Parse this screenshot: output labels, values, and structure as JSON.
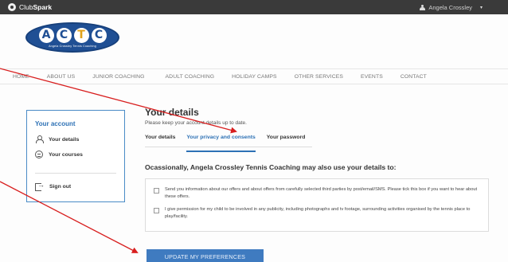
{
  "topbar": {
    "brand_prefix": "Club",
    "brand_suffix": "Spark",
    "user_name": "Angela Crossley",
    "chevron": "▾"
  },
  "logo": {
    "letters": [
      "A",
      "C",
      "T",
      "C"
    ],
    "subtitle": "Angela Crossley Tennis Coaching"
  },
  "nav": {
    "items": [
      "HOME",
      "ABOUT US",
      "JUNIOR COACHING",
      "ADULT COACHING",
      "HOLIDAY CAMPS",
      "OTHER SERVICES",
      "EVENTS",
      "CONTACT"
    ]
  },
  "sidebar": {
    "title": "Your account",
    "items": [
      {
        "label": "Your details",
        "icon": "person-icon"
      },
      {
        "label": "Your courses",
        "icon": "courses-icon"
      }
    ],
    "signout_label": "Sign out"
  },
  "main": {
    "title": "Your details",
    "subtitle": "Please keep your account details up to date.",
    "tabs": [
      {
        "label": "Your details",
        "active": false
      },
      {
        "label": "Your privacy and consents",
        "active": true
      },
      {
        "label": "Your password",
        "active": false
      }
    ],
    "section_heading": "Ocassionally, Angela Crossley Tennis Coaching may also use your details to:",
    "consents": [
      {
        "text": "Send you information about our offers and about offers from carefully selected third parties by post/email/SMS. Please tick this box if you want to hear about these offers.",
        "checked": false
      },
      {
        "text": "I give permission for my child to be involved in any publicity, including photographs and tv footage, surrounding activities organised by the tennis place to play/facility.",
        "checked": false
      }
    ],
    "update_button": "UPDATE MY PREFERENCES"
  },
  "colors": {
    "accent": "#2d71b5",
    "button": "#3f7bc0",
    "topbar": "#3a3a3a",
    "annotation_arrow": "#d81e1e"
  }
}
